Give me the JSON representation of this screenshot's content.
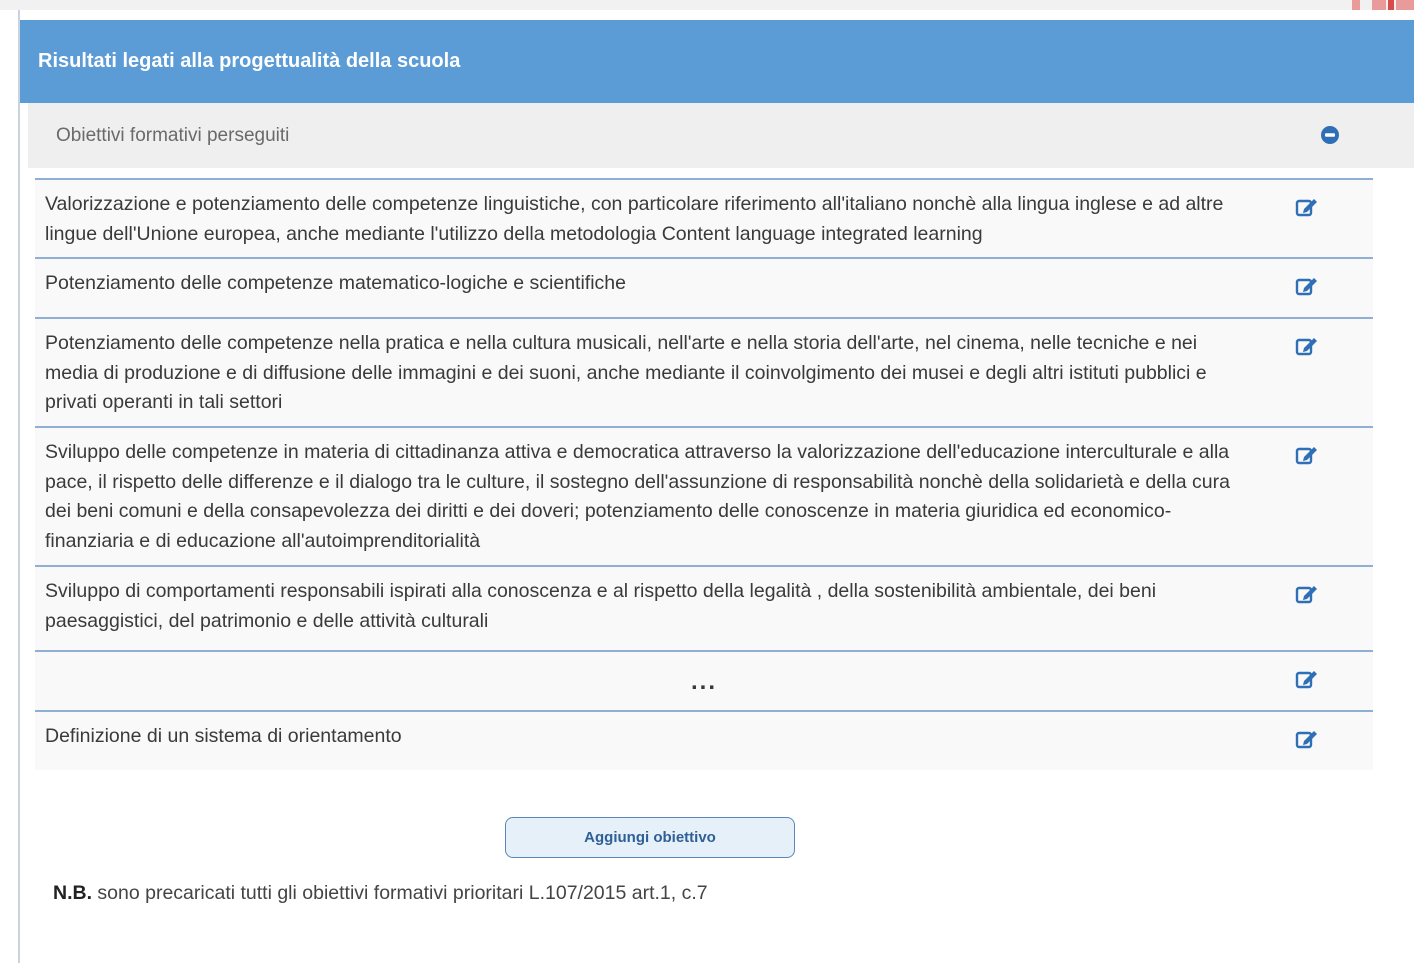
{
  "panel": {
    "header_title": "Risultati legati alla progettualità della scuola",
    "section_title": "Obiettivi formativi perseguiti"
  },
  "objectives": [
    {
      "lines": [
        "Valorizzazione e potenziamento delle competenze linguistiche, con particolare riferimento all'italiano nonchè alla lingua inglese e ad altre",
        "lingue dell'Unione europea, anche mediante l'utilizzo della metodologia Content language integrated learning"
      ]
    },
    {
      "lines": [
        "Potenziamento delle competenze matematico-logiche e scientifiche"
      ]
    },
    {
      "lines": [
        "Potenziamento delle competenze nella pratica e nella cultura musicali, nell'arte e nella storia dell'arte, nel cinema, nelle tecniche e nei",
        "media di produzione e di diffusione delle immagini e dei suoni, anche mediante il coinvolgimento dei musei e degli altri istituti pubblici e",
        "privati operanti in tali settori"
      ]
    },
    {
      "lines": [
        "Sviluppo delle competenze in materia di cittadinanza attiva e democratica attraverso la valorizzazione dell'educazione interculturale e alla",
        "pace, il rispetto delle differenze e il dialogo tra le culture, il sostegno dell'assunzione di responsabilità  nonchè della solidarietà  e della cura",
        "dei beni comuni e della consapevolezza dei diritti e dei doveri; potenziamento delle conoscenze in materia giuridica ed economico-",
        "finanziaria e di educazione all'autoimprenditorialità"
      ]
    },
    {
      "lines": [
        "Sviluppo di comportamenti responsabili ispirati alla conoscenza e al rispetto della legalità , della sostenibilità ambientale, dei beni",
        "paesaggistici, del patrimonio e delle attività culturali"
      ]
    },
    {
      "lines": [
        "..."
      ]
    },
    {
      "lines": [
        "Definizione di un sistema di orientamento"
      ]
    }
  ],
  "actions": {
    "add_label": "Aggiungi obiettivo"
  },
  "note": {
    "prefix": "N.B.",
    "text": " sono precaricati tutti gli obiettivi formativi prioritari L.107/2015 art.1, c.7"
  },
  "icons": {
    "collapse": "minus-circle-icon",
    "edit": "edit-icon"
  },
  "colors": {
    "header": "#5b9bd6",
    "accent": "#2e6fb5"
  }
}
